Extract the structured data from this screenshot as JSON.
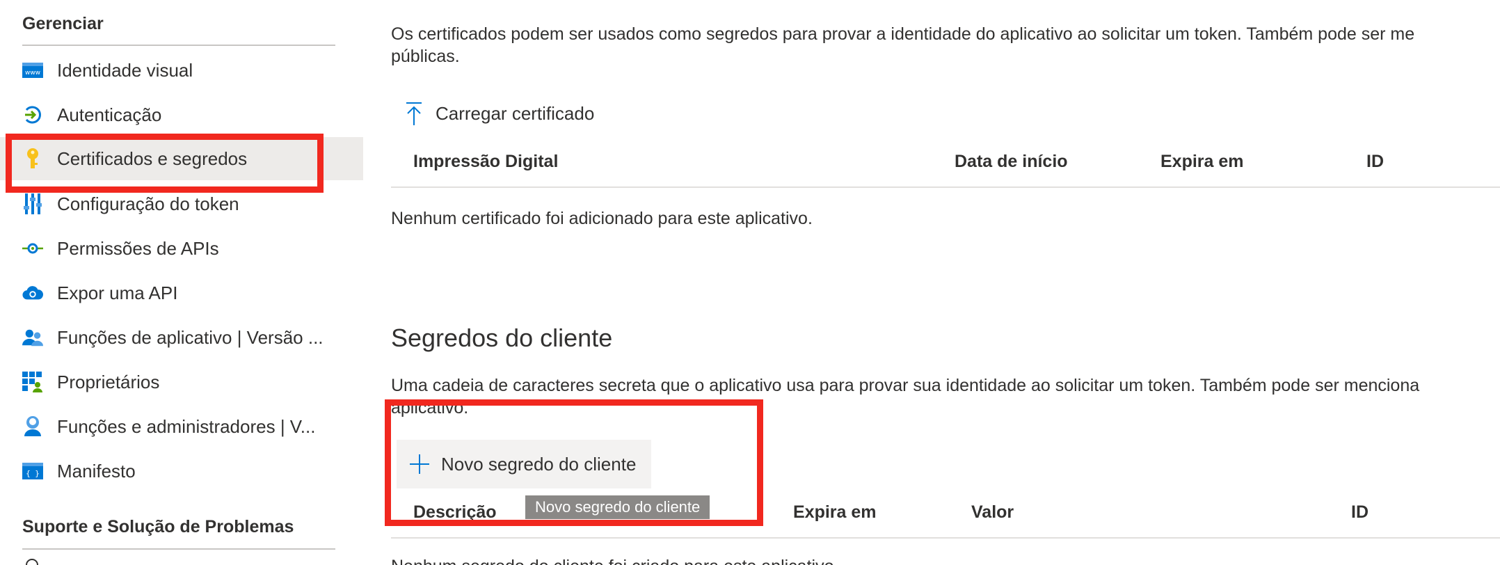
{
  "sidebar": {
    "manage_header": "Gerenciar",
    "items": [
      {
        "label": "Identidade visual",
        "icon": "branding-icon"
      },
      {
        "label": "Autenticação",
        "icon": "authentication-icon"
      },
      {
        "label": "Certificados e segredos",
        "icon": "key-icon"
      },
      {
        "label": "Configuração do token",
        "icon": "token-config-icon"
      },
      {
        "label": "Permissões de APIs",
        "icon": "api-permissions-icon"
      },
      {
        "label": "Expor uma API",
        "icon": "cloud-api-icon"
      },
      {
        "label": "Funções de aplicativo | Versão ...",
        "icon": "app-roles-icon"
      },
      {
        "label": "Proprietários",
        "icon": "owners-icon"
      },
      {
        "label": "Funções e administradores | V...",
        "icon": "roles-admins-icon"
      },
      {
        "label": "Manifesto",
        "icon": "manifest-icon"
      }
    ],
    "support_header": "Suporte e Solução de Problemas",
    "selected_index": 2
  },
  "certificates": {
    "description_line1": "Os certificados podem ser usados como segredos para provar a identidade do aplicativo ao solicitar um token. Também pode ser me",
    "description_line2": "públicas.",
    "upload_button": "Carregar certificado",
    "columns": [
      "Impressão Digital",
      "Data de início",
      "Expira em",
      "ID"
    ],
    "empty_message": "Nenhum certificado foi adicionado para este aplicativo."
  },
  "secrets": {
    "title": "Segredos do cliente",
    "description_line1": "Uma cadeia de caracteres secreta que o aplicativo usa para provar sua identidade ao solicitar um token. Também pode ser menciona",
    "description_line2": "aplicativo.",
    "new_button": "Novo segredo do cliente",
    "tooltip": "Novo segredo do cliente",
    "columns": [
      "Descrição",
      "Expira em",
      "Valor",
      "ID"
    ],
    "empty_message": "Nenhum segredo do cliente foi criado para este aplicativo."
  },
  "colors": {
    "highlight": "#f1281f",
    "accent_blue": "#0078d4",
    "selected_bg": "#edebe9"
  }
}
